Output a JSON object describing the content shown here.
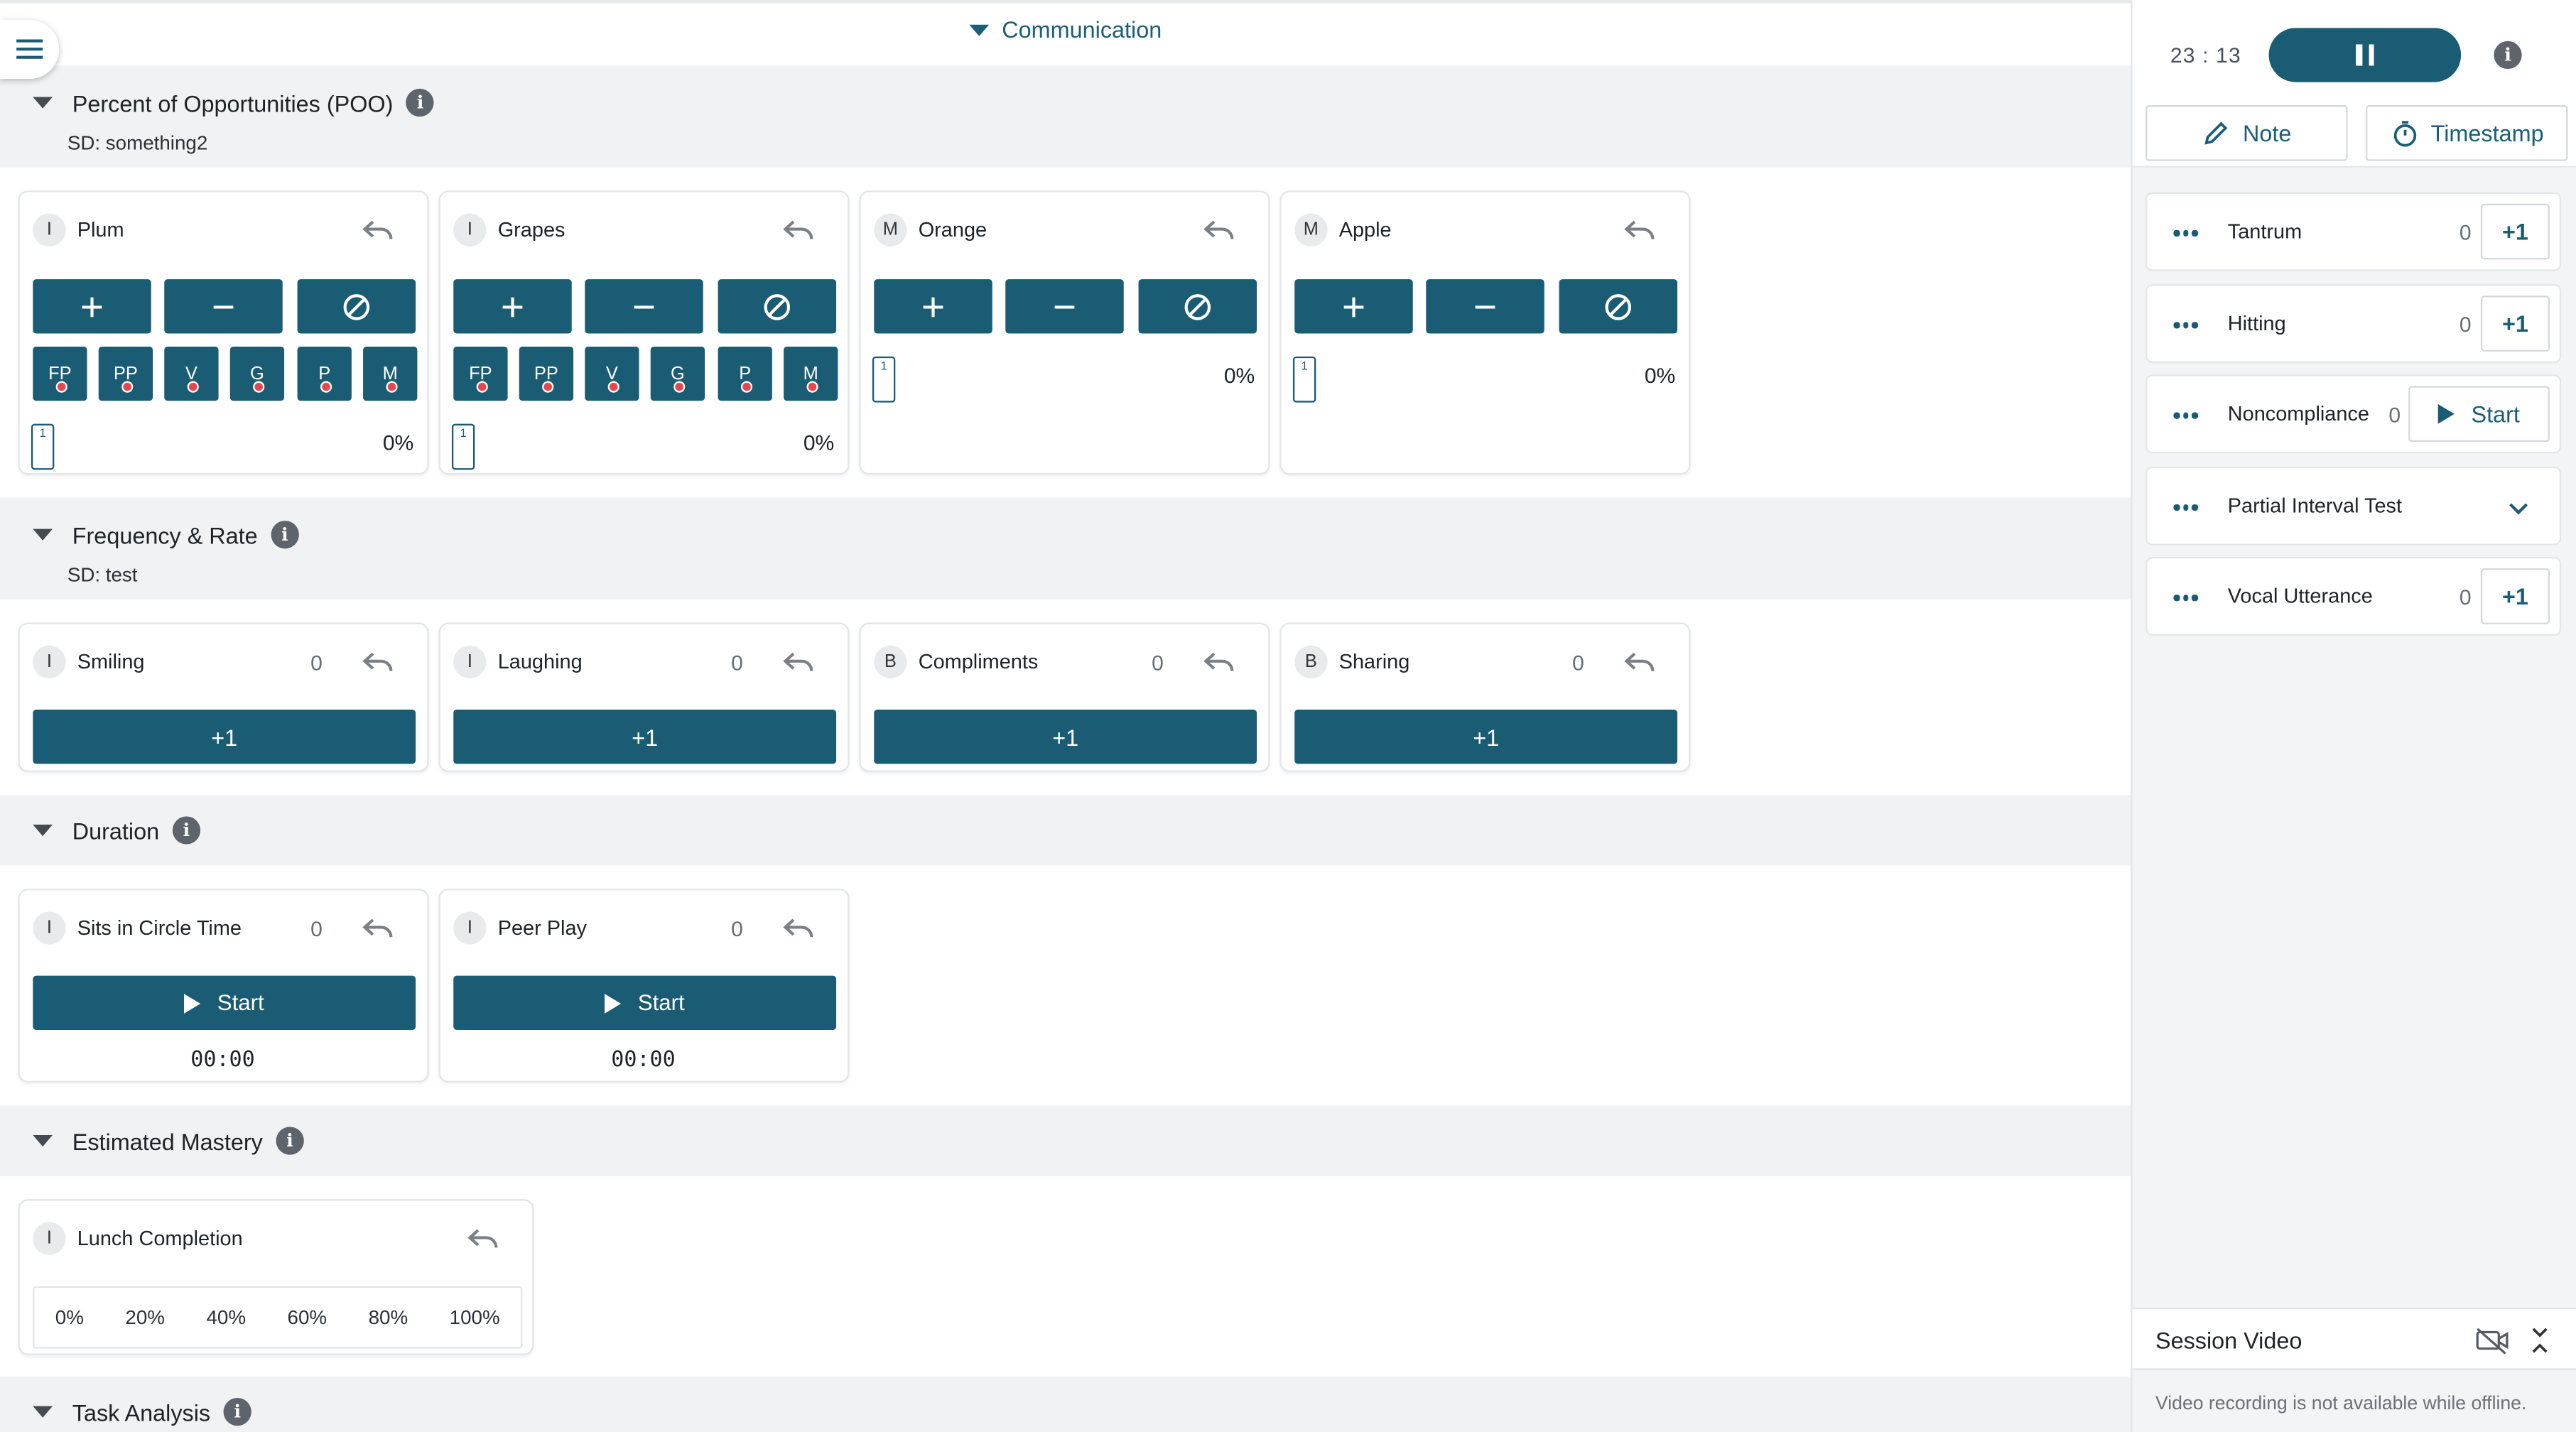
{
  "header": {
    "title": "Communication"
  },
  "sections": {
    "poo": {
      "title": "Percent of Opportunities (POO)",
      "sd": "SD: something2"
    },
    "freq": {
      "title": "Frequency & Rate",
      "sd": "SD: test"
    },
    "duration": {
      "title": "Duration"
    },
    "mastery": {
      "title": "Estimated Mastery"
    },
    "task": {
      "title": "Task Analysis"
    }
  },
  "poo_targets": [
    {
      "badge": "I",
      "name": "Plum",
      "trial": "1",
      "percent": "0%",
      "prompts": [
        "FP",
        "PP",
        "V",
        "G",
        "P",
        "M"
      ]
    },
    {
      "badge": "I",
      "name": "Grapes",
      "trial": "1",
      "percent": "0%",
      "prompts": [
        "FP",
        "PP",
        "V",
        "G",
        "P",
        "M"
      ]
    },
    {
      "badge": "M",
      "name": "Orange",
      "trial": "1",
      "percent": "0%"
    },
    {
      "badge": "M",
      "name": "Apple",
      "trial": "1",
      "percent": "0%"
    }
  ],
  "freq_targets": [
    {
      "badge": "I",
      "name": "Smiling",
      "count": "0",
      "button": "+1"
    },
    {
      "badge": "I",
      "name": "Laughing",
      "count": "0",
      "button": "+1"
    },
    {
      "badge": "B",
      "name": "Compliments",
      "count": "0",
      "button": "+1"
    },
    {
      "badge": "B",
      "name": "Sharing",
      "count": "0",
      "button": "+1"
    }
  ],
  "duration_targets": [
    {
      "badge": "I",
      "name": "Sits in Circle Time",
      "count": "0",
      "button": "Start",
      "timer": "00:00"
    },
    {
      "badge": "I",
      "name": "Peer Play",
      "count": "0",
      "button": "Start",
      "timer": "00:00"
    }
  ],
  "mastery_target": {
    "badge": "I",
    "name": "Lunch Completion",
    "options": [
      "0%",
      "20%",
      "40%",
      "60%",
      "80%",
      "100%"
    ]
  },
  "sidebar": {
    "clock": "23 : 13",
    "note_label": "Note",
    "timestamp_label": "Timestamp",
    "behaviors": [
      {
        "name": "Tantrum",
        "count": "0",
        "action": "+1"
      },
      {
        "name": "Hitting",
        "count": "0",
        "action": "+1"
      },
      {
        "name": "Noncompliance",
        "count": "0",
        "action": "Start"
      },
      {
        "name": "Partial Interval Test"
      },
      {
        "name": "Vocal Utterance",
        "count": "0",
        "action": "+1"
      }
    ],
    "video_title": "Session Video",
    "video_message": "Video recording is not available while offline."
  },
  "colors": {
    "primary": "#1b5c75",
    "accent_text": "#1b5e78",
    "section_bg": "#f1f2f4",
    "prompt_dot": "#e8464f"
  }
}
